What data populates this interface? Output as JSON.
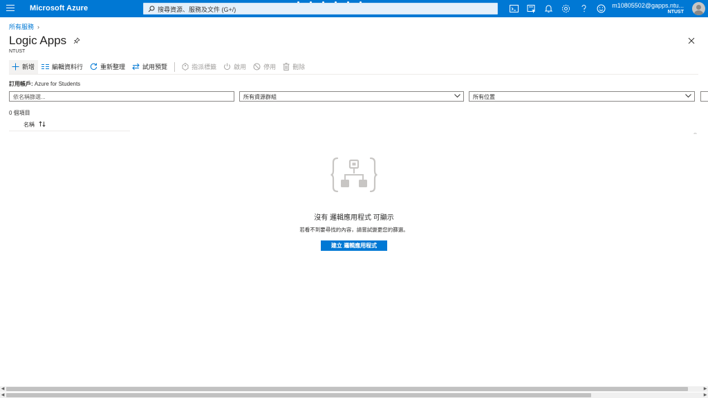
{
  "topbar": {
    "brand": "Microsoft Azure",
    "search_placeholder": "搜尋資源、服務及文件 (G+/)",
    "account_email": "m10805502@gapps.ntu...",
    "account_tenant": "NTUST"
  },
  "breadcrumb": {
    "item": "所有服務"
  },
  "page": {
    "title": "Logic Apps",
    "subtitle": "NTUST"
  },
  "toolbar": {
    "add": "新增",
    "edit_columns": "編輯資料行",
    "refresh": "重新整理",
    "try_preview": "試用預覽",
    "assign_tags": "指派標籤",
    "enable": "啟用",
    "disable": "停用",
    "delete": "刪除"
  },
  "filters": {
    "subscription_label": "訂用帳戶:",
    "subscription_value": "Azure for Students",
    "name_placeholder": "依名稱篩選...",
    "resource_group": "所有資源群組",
    "location": "所有位置"
  },
  "list": {
    "count": "0 個項目",
    "column_name": "名稱"
  },
  "empty_state": {
    "title": "沒有 邏輯應用程式 可顯示",
    "description": "若看不到要尋找的內容，請嘗試變更您的篩選。",
    "create_button": "建立 邏輯應用程式"
  },
  "colors": {
    "accent": "#0078d4"
  }
}
